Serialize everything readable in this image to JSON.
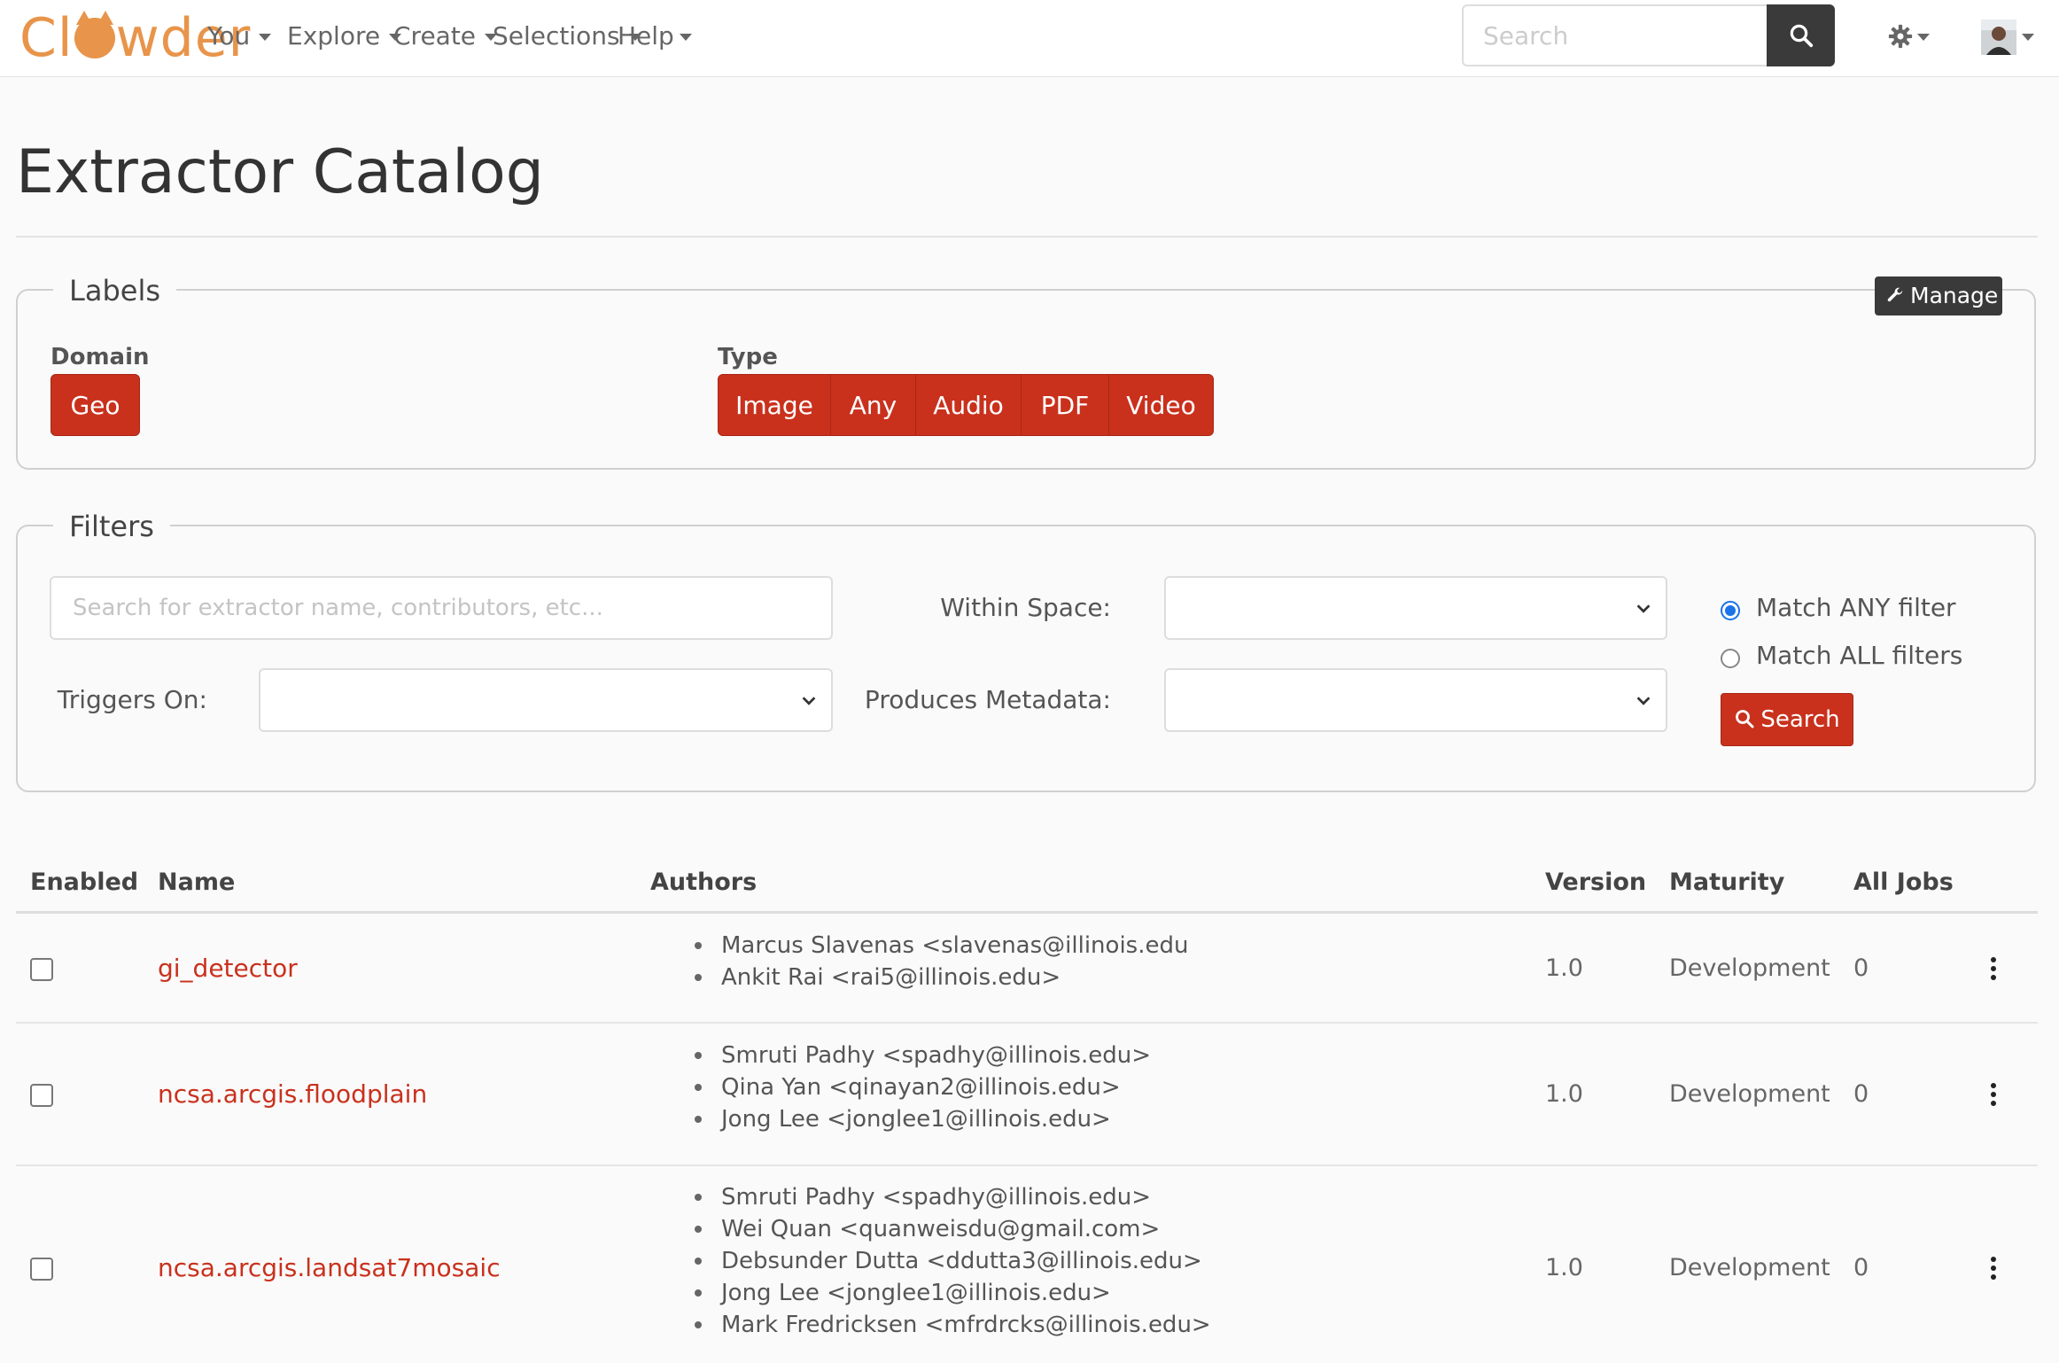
{
  "nav": {
    "brand": [
      "Cl",
      "wder"
    ],
    "items": [
      "You",
      "Explore",
      "Create",
      "Selections",
      "Help"
    ],
    "search_placeholder": "Search"
  },
  "page": {
    "title": "Extractor Catalog"
  },
  "labels": {
    "legend": "Labels",
    "manage_label": "Manage",
    "domain_label": "Domain",
    "domain_tags": [
      "Geo"
    ],
    "type_label": "Type",
    "type_tags": [
      "Image",
      "Any",
      "Audio",
      "PDF",
      "Video"
    ]
  },
  "filters": {
    "legend": "Filters",
    "search_placeholder": "Search for extractor name, contributors, etc...",
    "within_space_label": "Within Space:",
    "triggers_on_label": "Triggers On:",
    "produces_metadata_label": "Produces Metadata:",
    "match_any_label": "Match ANY filter",
    "match_all_label": "Match ALL filters",
    "search_button": "Search"
  },
  "table": {
    "columns": [
      "Enabled",
      "Name",
      "Authors",
      "Version",
      "Maturity",
      "All Jobs"
    ],
    "rows": [
      {
        "name": "gi_detector",
        "authors": [
          "Marcus Slavenas <slavenas@illinois.edu",
          "Ankit Rai <rai5@illinois.edu>"
        ],
        "version": "1.0",
        "maturity": "Development",
        "jobs": "0"
      },
      {
        "name": "ncsa.arcgis.floodplain",
        "authors": [
          "Smruti Padhy <spadhy@illinois.edu>",
          "Qina Yan <qinayan2@illinois.edu>",
          "Jong Lee <jonglee1@illinois.edu>"
        ],
        "version": "1.0",
        "maturity": "Development",
        "jobs": "0"
      },
      {
        "name": "ncsa.arcgis.landsat7mosaic",
        "authors": [
          "Smruti Padhy <spadhy@illinois.edu>",
          "Wei Quan <quanweisdu@gmail.com>",
          "Debsunder Dutta <ddutta3@illinois.edu>",
          "Jong Lee <jonglee1@illinois.edu>",
          "Mark Fredricksen <mfrdrcks@illinois.edu>"
        ],
        "version": "1.0",
        "maturity": "Development",
        "jobs": "0"
      }
    ]
  },
  "colors": {
    "brand": "#e8944a",
    "accent": "#c9311d",
    "dark_button": "#3a3a3a",
    "radio_selected": "#1a73e8"
  },
  "icons": {
    "search": "search-icon",
    "settings": "gear-icon",
    "manage": "wrench-icon",
    "row_menu": "more-vertical-icon"
  }
}
